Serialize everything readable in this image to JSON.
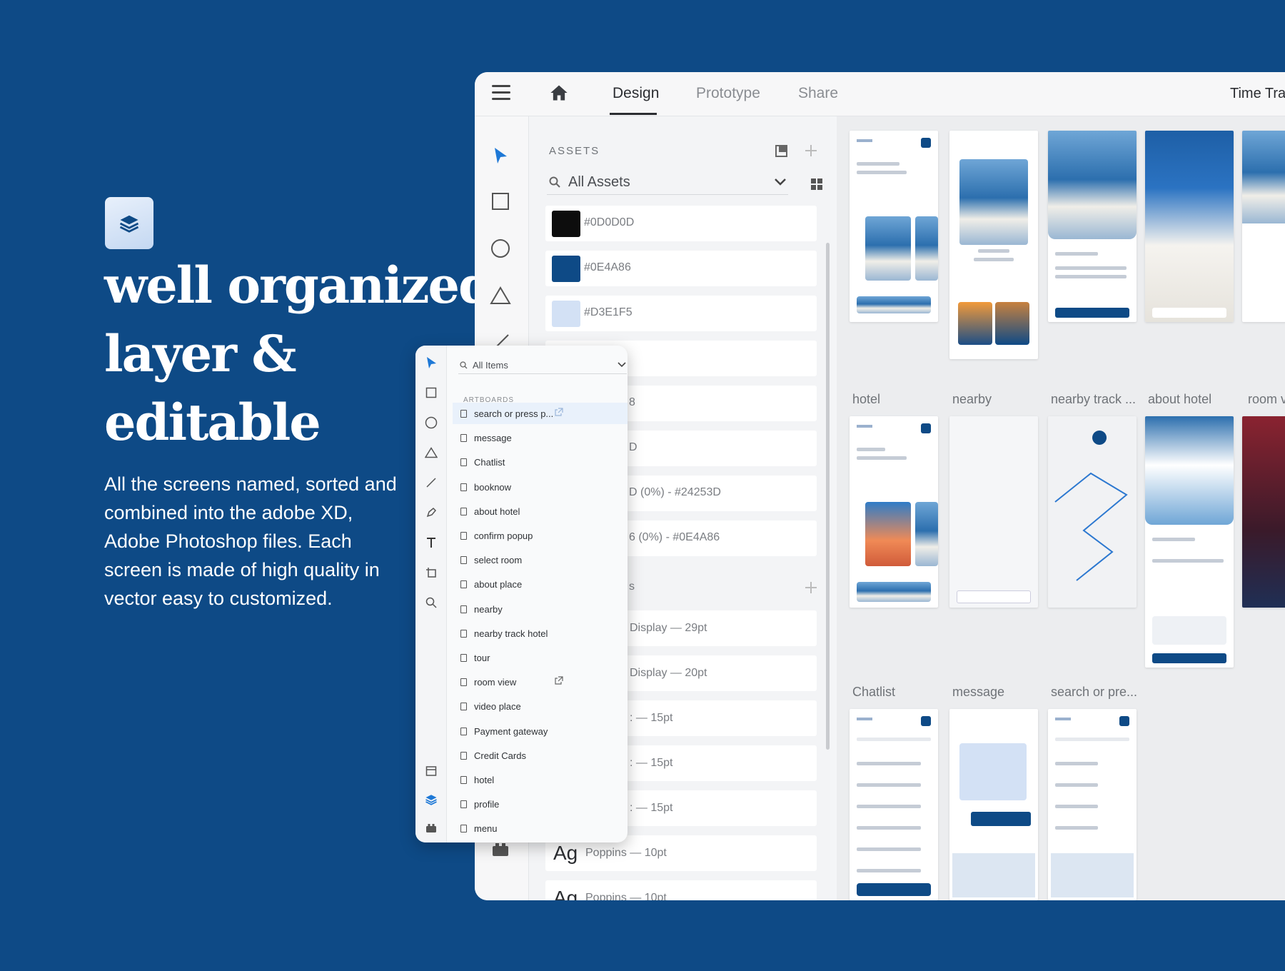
{
  "promo": {
    "headline_1": "well organized",
    "headline_2": "layer &",
    "headline_3": "editable",
    "description": "All the screens named, sorted and combined into the adobe XD, Adobe Photoshop files. Each screen is made of high quality in vector easy to customized."
  },
  "app": {
    "tabs": [
      {
        "label": "Design"
      },
      {
        "label": "Prototype"
      },
      {
        "label": "Share"
      }
    ],
    "document_title": "Time Trav"
  },
  "assets": {
    "title": "ASSETS",
    "filter_label": "All Assets",
    "colors": [
      {
        "label": "#0D0D0D",
        "hex": "#0D0D0D"
      },
      {
        "label": "#0E4A86",
        "hex": "#0E4A86"
      },
      {
        "label": "#D3E1F5",
        "hex": "#D3E1F5"
      }
    ],
    "partial_rows": [
      "",
      "8",
      "D",
      "D (0%) - #24253D",
      "6 (0%) - #0E4A86"
    ],
    "partial_header": "s",
    "char_styles": [
      "Display — 29pt",
      "Display — 20pt",
      ": — 15pt",
      ": — 15pt",
      ": — 15pt"
    ],
    "ag_glyph": "Ag",
    "ag_style": "Poppins — 10pt",
    "ag_style_2": "Poppins — 10pt"
  },
  "canvas": {
    "labels_row2": [
      "hotel",
      "nearby",
      "nearby track ...",
      "about hotel",
      "room v"
    ],
    "labels_row3": [
      "Chatlist",
      "message",
      "search or pre..."
    ]
  },
  "layers": {
    "filter_label": "All Items",
    "section": "ARTBOARDS",
    "items": [
      "search or press p...",
      "message",
      "Chatlist",
      "booknow",
      "about hotel",
      "confirm popup",
      "select room",
      "about place",
      "nearby",
      "nearby track hotel",
      "tour",
      "room view",
      "video place",
      "Payment gateway",
      "Credit Cards",
      "hotel",
      "profile",
      "menu"
    ]
  }
}
